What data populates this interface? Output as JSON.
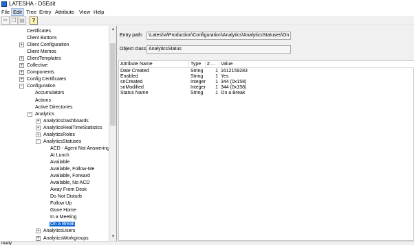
{
  "window": {
    "title": "LATESHA - DSEdit",
    "icon": "app-icon"
  },
  "menu": [
    "File",
    "Edit",
    "Tree",
    "Entry",
    "Attribute",
    "View",
    "Help"
  ],
  "menu_active_index": 1,
  "toolbar": {
    "cut_icon": "cut-icon",
    "copy_icon": "copy-icon",
    "paste_icon": "paste-icon",
    "help_icon": "help-icon",
    "help_glyph": "?"
  },
  "tree": [
    {
      "label": "Certificates",
      "expander": "",
      "selected": false
    },
    {
      "label": "Client Buttons",
      "expander": "",
      "selected": false
    },
    {
      "label": "Client Configuration",
      "expander": "+",
      "selected": false
    },
    {
      "label": "Client Memos",
      "expander": "",
      "selected": false
    },
    {
      "label": "ClientTemplates",
      "expander": "+",
      "selected": false
    },
    {
      "label": "Collective",
      "expander": "+",
      "selected": false
    },
    {
      "label": "Components",
      "expander": "+",
      "selected": false
    },
    {
      "label": "Config Certificates",
      "expander": "+",
      "selected": false
    },
    {
      "label": "Configuration",
      "expander": "-",
      "selected": false
    },
    {
      "label": "Accumulators",
      "expander": "",
      "selected": false
    },
    {
      "label": "Actions",
      "expander": "",
      "selected": false
    },
    {
      "label": "Active Directories",
      "expander": "",
      "selected": false
    },
    {
      "label": "Analytics",
      "expander": "-",
      "selected": false
    },
    {
      "label": "AnalyticsDashboards",
      "expander": "+",
      "selected": false
    },
    {
      "label": "AnalyticsRealTimeStatistics",
      "expander": "+",
      "selected": false
    },
    {
      "label": "AnalyticsRoles",
      "expander": "+",
      "selected": false
    },
    {
      "label": "AnalyticsStatuses",
      "expander": "-",
      "selected": false
    },
    {
      "label": "ACD - Agent Not Answering",
      "expander": "",
      "selected": false
    },
    {
      "label": "At Lunch",
      "expander": "",
      "selected": false
    },
    {
      "label": "Available",
      "expander": "",
      "selected": false
    },
    {
      "label": "Available, Follow-Me",
      "expander": "",
      "selected": false
    },
    {
      "label": "Available, Forward",
      "expander": "",
      "selected": false
    },
    {
      "label": "Available, No ACD",
      "expander": "",
      "selected": false
    },
    {
      "label": "Away From Desk",
      "expander": "",
      "selected": false
    },
    {
      "label": "Do Not Disturb",
      "expander": "",
      "selected": false
    },
    {
      "label": "Follow Up",
      "expander": "",
      "selected": false
    },
    {
      "label": "Gone Home",
      "expander": "",
      "selected": false
    },
    {
      "label": "In a Meeting",
      "expander": "",
      "selected": false
    },
    {
      "label": "On a Break",
      "expander": "",
      "selected": true
    },
    {
      "label": "AnalyticsUsers",
      "expander": "+",
      "selected": false
    },
    {
      "label": "AnalyticsWorkgroups",
      "expander": "+",
      "selected": false
    }
  ],
  "entry": {
    "path_label": "Entry path:",
    "path_value": "\\Latesha\\Production\\Configuration\\Analytics\\AnalyticsStatuses\\On a Break",
    "class_label": "Object class:",
    "class_value": "AnalyticsStatus"
  },
  "attributes": {
    "headers": [
      "Attribute Name",
      "Type",
      "# ...",
      "Value"
    ],
    "rows": [
      [
        "Date Created",
        "String",
        "1",
        "1612159283"
      ],
      [
        "Enabled",
        "String",
        "1",
        "Yes"
      ],
      [
        "snCreated",
        "Integer",
        "1",
        "344 (0x158)"
      ],
      [
        "snModified",
        "Integer",
        "1",
        "344 (0x158)"
      ],
      [
        "Status Name",
        "String",
        "1",
        "On a Break"
      ]
    ]
  },
  "status": {
    "text": "ready"
  }
}
